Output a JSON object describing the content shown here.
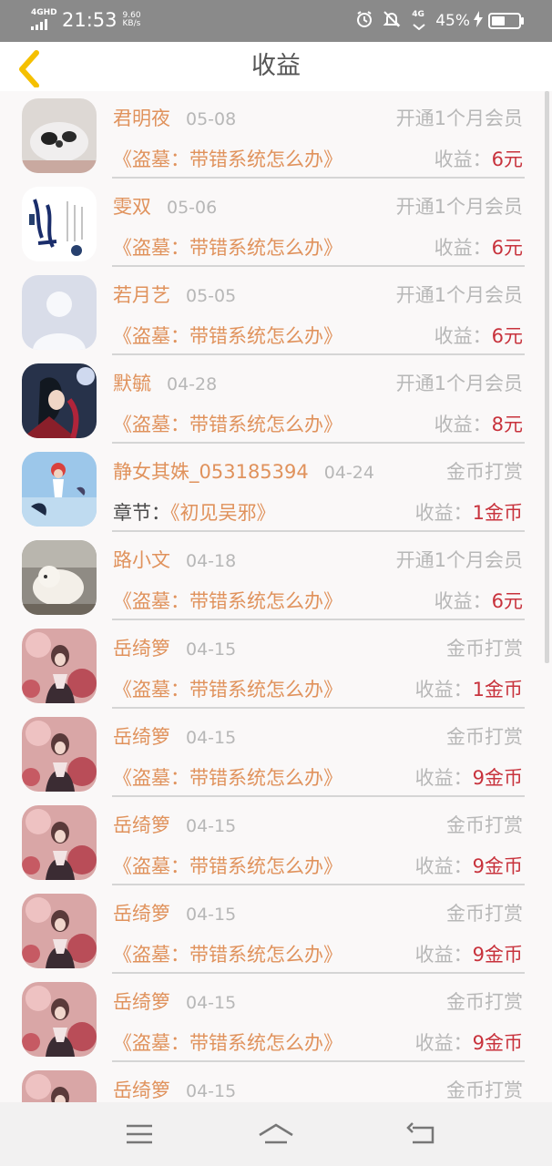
{
  "status_bar": {
    "network": "4GHD",
    "time": "21:53",
    "speed_value": "9.60",
    "speed_unit": "KB/s",
    "mobile_data": "4G",
    "battery_pct": "45%",
    "battery_level": 0.45
  },
  "header": {
    "title": "收益",
    "back_icon": "chevron-left-icon"
  },
  "rows": [
    {
      "name": "君明夜",
      "date": "05-08",
      "type": "开通1个月会员",
      "prefix": "",
      "work": "《盗墓：带错系统怎么办》",
      "income_label": "收益：",
      "amount": "6元",
      "avatar": "panda"
    },
    {
      "name": "雯双",
      "date": "05-06",
      "type": "开通1个月会员",
      "prefix": "",
      "work": "《盗墓：带错系统怎么办》",
      "income_label": "收益：",
      "amount": "6元",
      "avatar": "calligraphy"
    },
    {
      "name": "若月艺",
      "date": "05-05",
      "type": "开通1个月会员",
      "prefix": "",
      "work": "《盗墓：带错系统怎么办》",
      "income_label": "收益：",
      "amount": "6元",
      "avatar": "default"
    },
    {
      "name": "默毓",
      "date": "04-28",
      "type": "开通1个月会员",
      "prefix": "",
      "work": "《盗墓：带错系统怎么办》",
      "income_label": "收益：",
      "amount": "8元",
      "avatar": "anime"
    },
    {
      "name": "静女其姝_053185394",
      "date": "04-24",
      "type": "金币打赏",
      "prefix": "章节：",
      "work": "《初见吴邪》",
      "income_label": "收益：",
      "amount": "1金币",
      "avatar": "sky"
    },
    {
      "name": "路小文",
      "date": "04-18",
      "type": "开通1个月会员",
      "prefix": "",
      "work": "《盗墓：带错系统怎么办》",
      "income_label": "收益：",
      "amount": "6元",
      "avatar": "sheep"
    },
    {
      "name": "岳绮箩",
      "date": "04-15",
      "type": "金币打赏",
      "prefix": "",
      "work": "《盗墓：带错系统怎么办》",
      "income_label": "收益：",
      "amount": "1金币",
      "avatar": "pink"
    },
    {
      "name": "岳绮箩",
      "date": "04-15",
      "type": "金币打赏",
      "prefix": "",
      "work": "《盗墓：带错系统怎么办》",
      "income_label": "收益：",
      "amount": "9金币",
      "avatar": "pink"
    },
    {
      "name": "岳绮箩",
      "date": "04-15",
      "type": "金币打赏",
      "prefix": "",
      "work": "《盗墓：带错系统怎么办》",
      "income_label": "收益：",
      "amount": "9金币",
      "avatar": "pink"
    },
    {
      "name": "岳绮箩",
      "date": "04-15",
      "type": "金币打赏",
      "prefix": "",
      "work": "《盗墓：带错系统怎么办》",
      "income_label": "收益：",
      "amount": "9金币",
      "avatar": "pink"
    },
    {
      "name": "岳绮箩",
      "date": "04-15",
      "type": "金币打赏",
      "prefix": "",
      "work": "《盗墓：带错系统怎么办》",
      "income_label": "收益：",
      "amount": "9金币",
      "avatar": "pink"
    },
    {
      "name": "岳绮箩",
      "date": "04-15",
      "type": "金币打赏",
      "prefix": "",
      "work": "",
      "income_label": "",
      "amount": "",
      "avatar": "pink"
    }
  ],
  "nav_bar": {
    "menu_icon": "menu-icon",
    "home_icon": "home-icon",
    "back_icon": "back-icon"
  },
  "colors": {
    "name": "#e0925c",
    "amount": "#c8323c",
    "muted": "#b7b7b7"
  }
}
